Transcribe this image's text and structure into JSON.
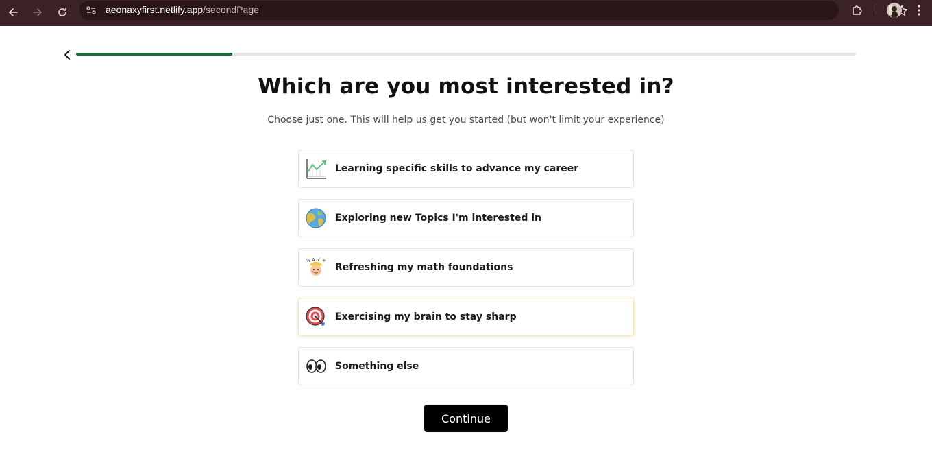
{
  "browser": {
    "url_host": "aeonaxyfirst.netlify.app",
    "url_path": "/secondPage"
  },
  "page": {
    "progress": 0.2,
    "title": "Which are you most interested in?",
    "subtitle": "Choose just one. This will help us get you started (but won't limit your experience)",
    "options": [
      {
        "label": "Learning specific skills to advance my career",
        "icon": "chart-growth-icon"
      },
      {
        "label": "Exploring new Topics I'm interested in",
        "icon": "globe-icon"
      },
      {
        "label": "Refreshing my math foundations",
        "icon": "math-head-icon"
      },
      {
        "label": "Exercising my brain to stay sharp",
        "icon": "target-icon",
        "selected": true
      },
      {
        "label": "Something else",
        "icon": "eyes-icon"
      }
    ],
    "continue_label": "Continue"
  },
  "colors": {
    "chrome_bg": "#3b2226",
    "progress_fill": "#1e6b3e",
    "selected_border": "#f3e6a6",
    "button_bg": "#000000"
  }
}
